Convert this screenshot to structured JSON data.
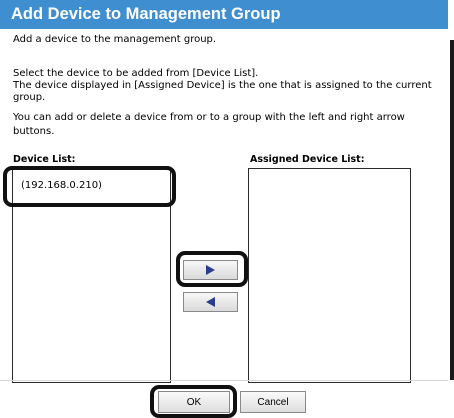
{
  "dialog": {
    "title": "Add Device to Management Group",
    "intro": "Add a device to the management group.",
    "instruction_line1": "Select the device to be added from [Device List].",
    "instruction_line2": "The device displayed in [Assigned Device] is the one that is assigned to the current group.",
    "instruction_line3": "You can add or delete a device from or to a group with the left and right arrow buttons."
  },
  "device_list": {
    "label": "Device List:",
    "items": [
      "(192.168.0.210)"
    ]
  },
  "assigned_list": {
    "label": "Assigned Device List:",
    "items": []
  },
  "arrows": {
    "add_icon": "arrow-right-icon",
    "remove_icon": "arrow-left-icon",
    "icon_color": "#2a3d8f"
  },
  "footer": {
    "ok_label": "OK",
    "cancel_label": "Cancel"
  },
  "colors": {
    "title_bar": "#3f8fd0",
    "callout": "#111111"
  }
}
